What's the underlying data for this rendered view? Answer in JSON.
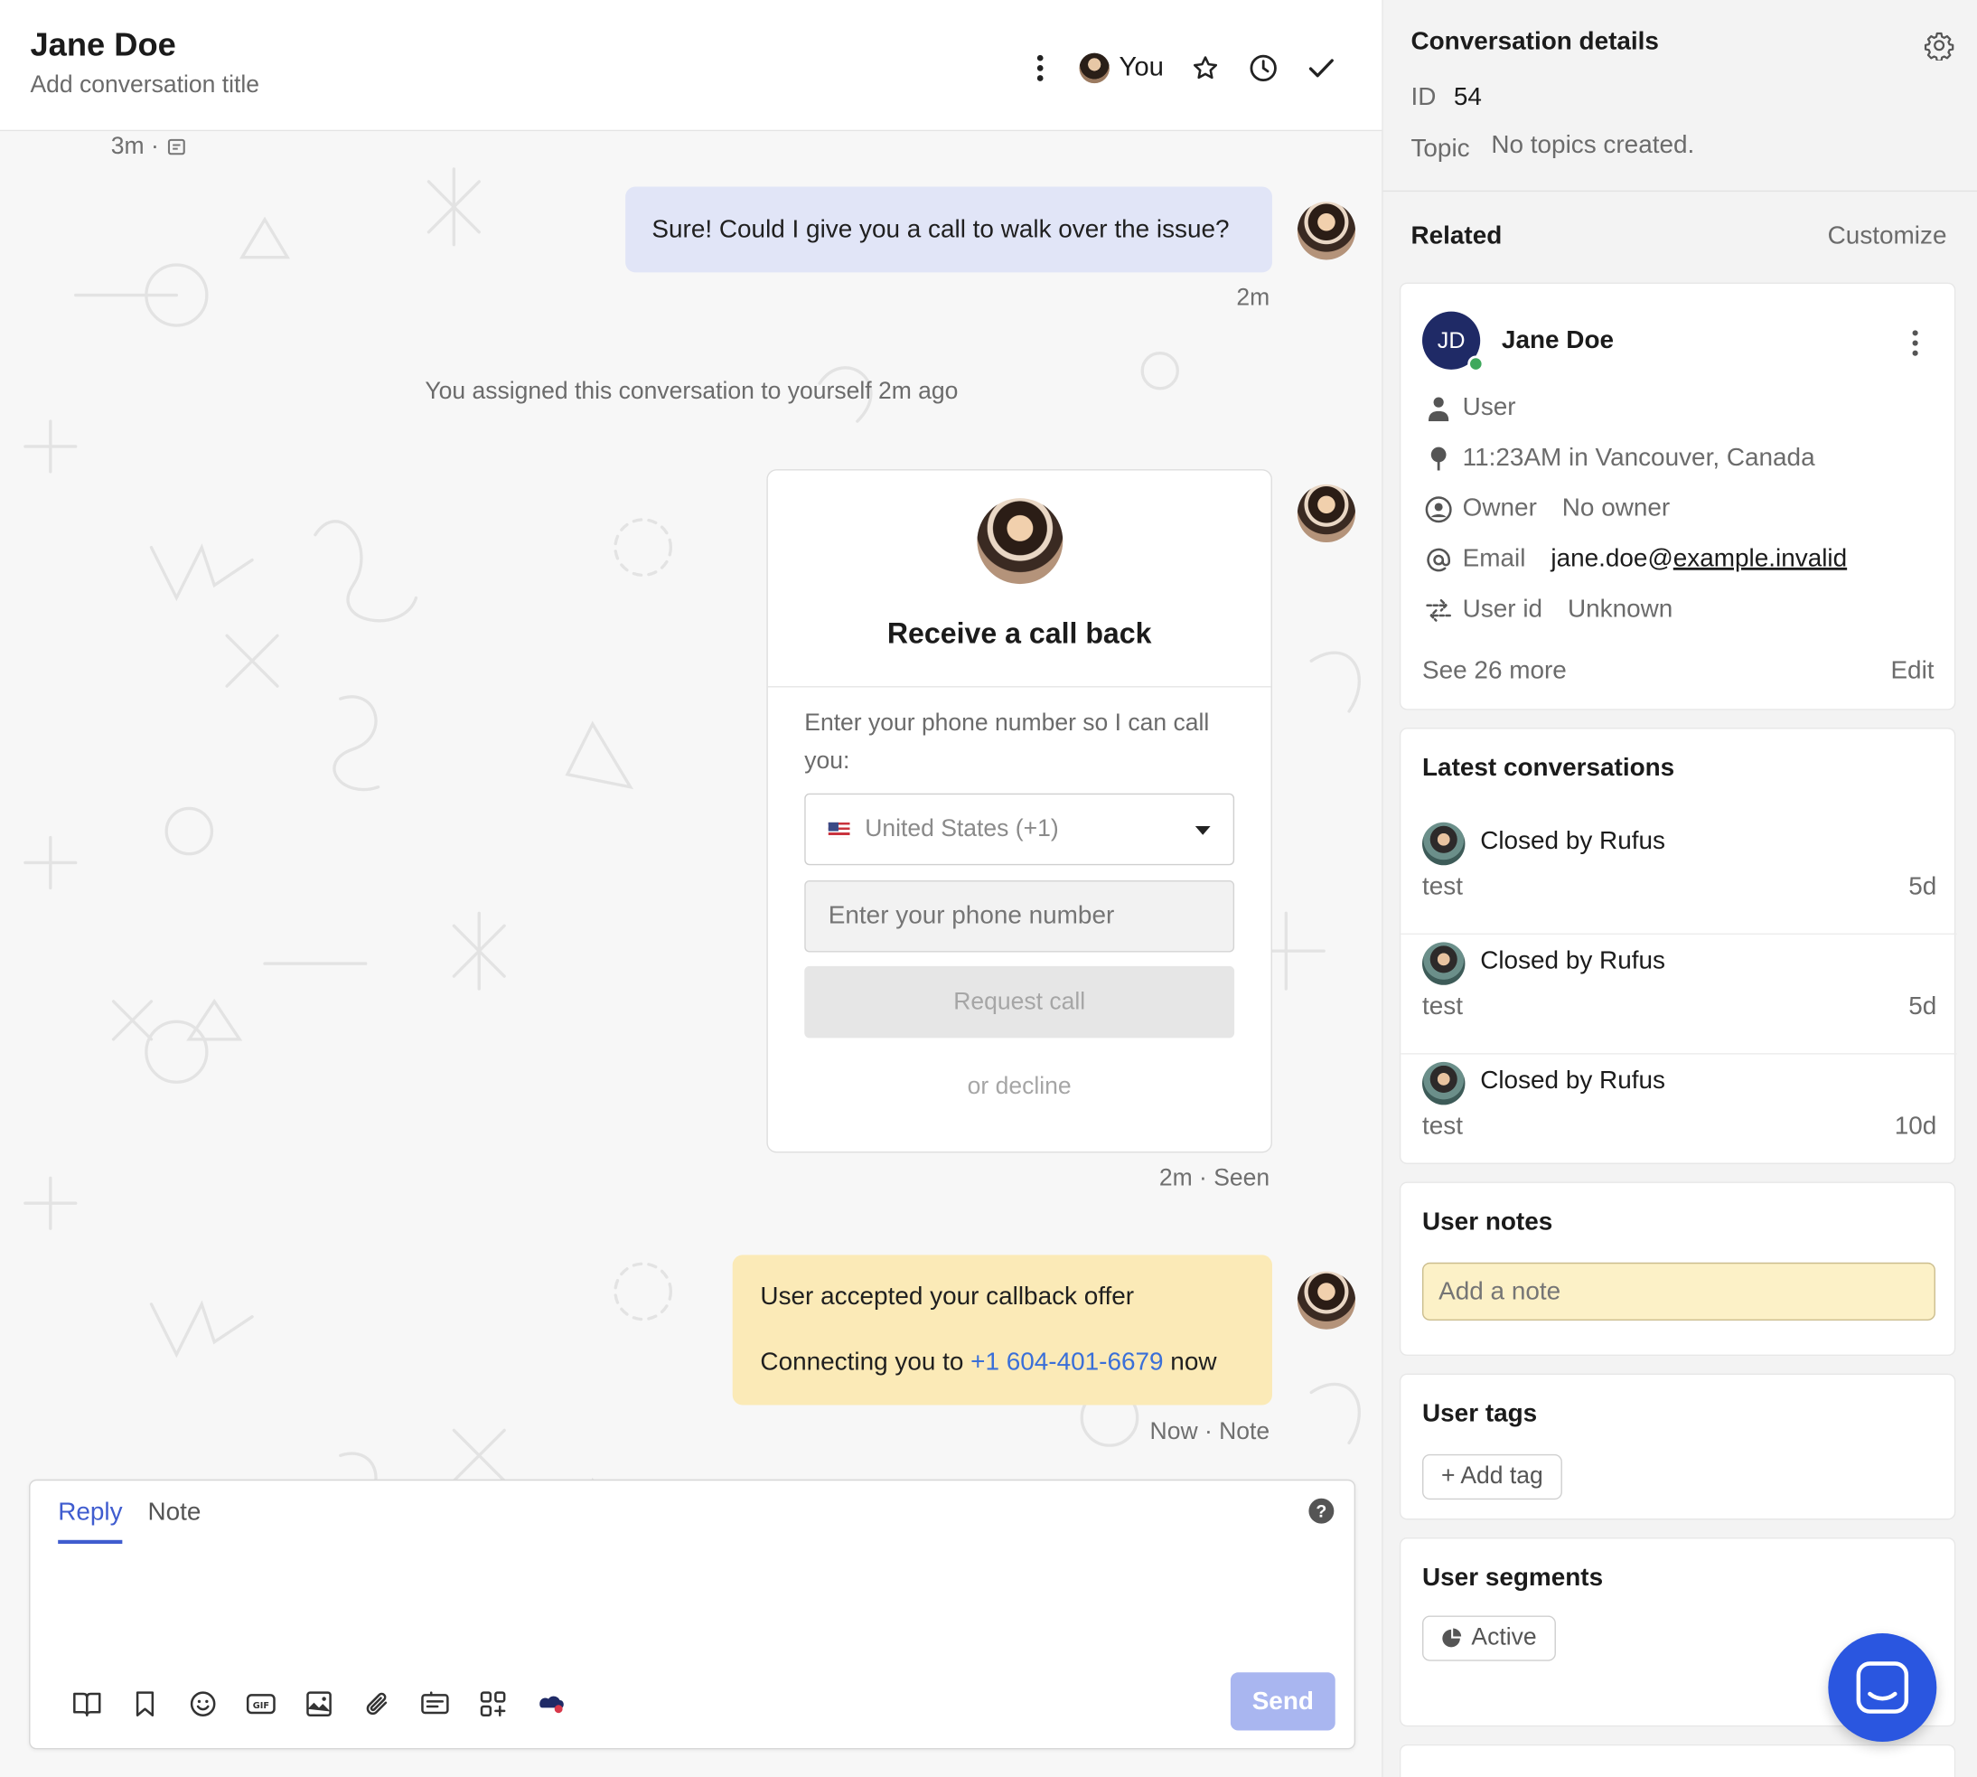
{
  "header": {
    "name": "Jane Doe",
    "subtitle": "Add conversation title",
    "assignee": "You"
  },
  "thread": {
    "first_stamp": "3m ·",
    "msg1": "Sure! Could I give you a call to walk over the issue?",
    "msg1_stamp": "2m",
    "system": "You assigned this conversation to yourself 2m ago",
    "card": {
      "title": "Receive a call back",
      "prompt": "Enter your phone number so I can call you:",
      "country": "United States (+1)",
      "phone_placeholder": "Enter your phone number",
      "request": "Request call",
      "decline": "or decline",
      "stamp": "2m · Seen"
    },
    "note": {
      "line1": "User accepted your callback offer",
      "line2_pre": "Connecting you to ",
      "phone": "+1 604-401-6679",
      "line2_post": " now",
      "stamp": "Now · Note"
    }
  },
  "composer": {
    "tabs": [
      "Reply",
      "Note"
    ],
    "help": "?",
    "send": "Send",
    "tools": [
      "book-icon",
      "bookmark-icon",
      "emoji-icon",
      "gif-icon",
      "image-icon",
      "attachment-icon",
      "article-icon",
      "apps-icon",
      "integration-icon"
    ]
  },
  "details": {
    "title": "Conversation details",
    "id_label": "ID",
    "id_value": "54",
    "topic_label": "Topic",
    "topic_value": "No topics created.",
    "related": "Related",
    "customize": "Customize",
    "user": {
      "initials": "JD",
      "name": "Jane Doe",
      "role": "User",
      "local_time": "11:23AM in Vancouver, Canada",
      "owner_label": "Owner",
      "owner_value": "No owner",
      "email_label": "Email",
      "email_user": "jane.doe@",
      "email_domain": "example.invalid",
      "userid_label": "User id",
      "userid_value": "Unknown",
      "see_more": "See 26 more",
      "edit": "Edit"
    },
    "latest": {
      "title": "Latest conversations",
      "items": [
        {
          "title": "Closed by Rufus",
          "preview": "test",
          "age": "5d"
        },
        {
          "title": "Closed by Rufus",
          "preview": "test",
          "age": "5d"
        },
        {
          "title": "Closed by Rufus",
          "preview": "test",
          "age": "10d"
        }
      ]
    },
    "notes": {
      "title": "User notes",
      "placeholder": "Add a note"
    },
    "tags": {
      "title": "User tags",
      "add": "+ Add tag"
    },
    "segments": {
      "title": "User segments",
      "chip": "Active"
    }
  }
}
